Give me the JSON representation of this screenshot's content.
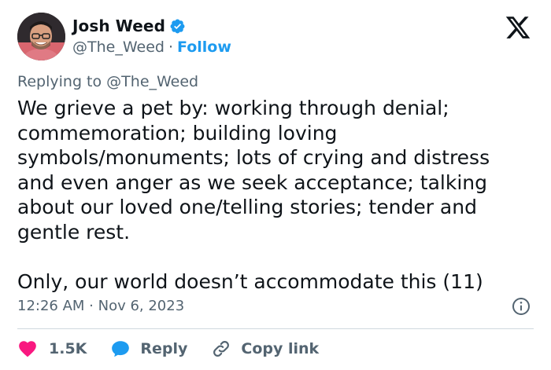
{
  "author": {
    "display_name": "Josh Weed",
    "handle": "@The_Weed",
    "separator": "·",
    "follow_label": "Follow",
    "verified": true
  },
  "tweet": {
    "replying_prefix": "Replying to",
    "replying_handle": "@The_Weed",
    "text": "We grieve a pet by: working through denial;\ncommemoration; building loving\nsymbols/monuments; lots of crying and distress\nand even anger as we seek acceptance; talking\nabout our loved one/telling stories; tender and\ngentle rest.\n\nOnly, our world doesn’t accommodate this (11)",
    "timestamp": "12:26 AM · Nov 6, 2023"
  },
  "actions": {
    "likes_count": "1.5K",
    "reply_label": "Reply",
    "copy_link_label": "Copy link"
  },
  "icons": {
    "verified": "verified-badge-icon",
    "platform": "x-logo-icon",
    "info": "info-icon",
    "like": "heart-icon",
    "reply": "speech-bubble-icon",
    "copy": "link-icon"
  },
  "colors": {
    "accent": "#1d9bf0",
    "like": "#f91880",
    "text_primary": "#0f1419",
    "text_secondary": "#536471",
    "divider": "#cfd9de"
  }
}
